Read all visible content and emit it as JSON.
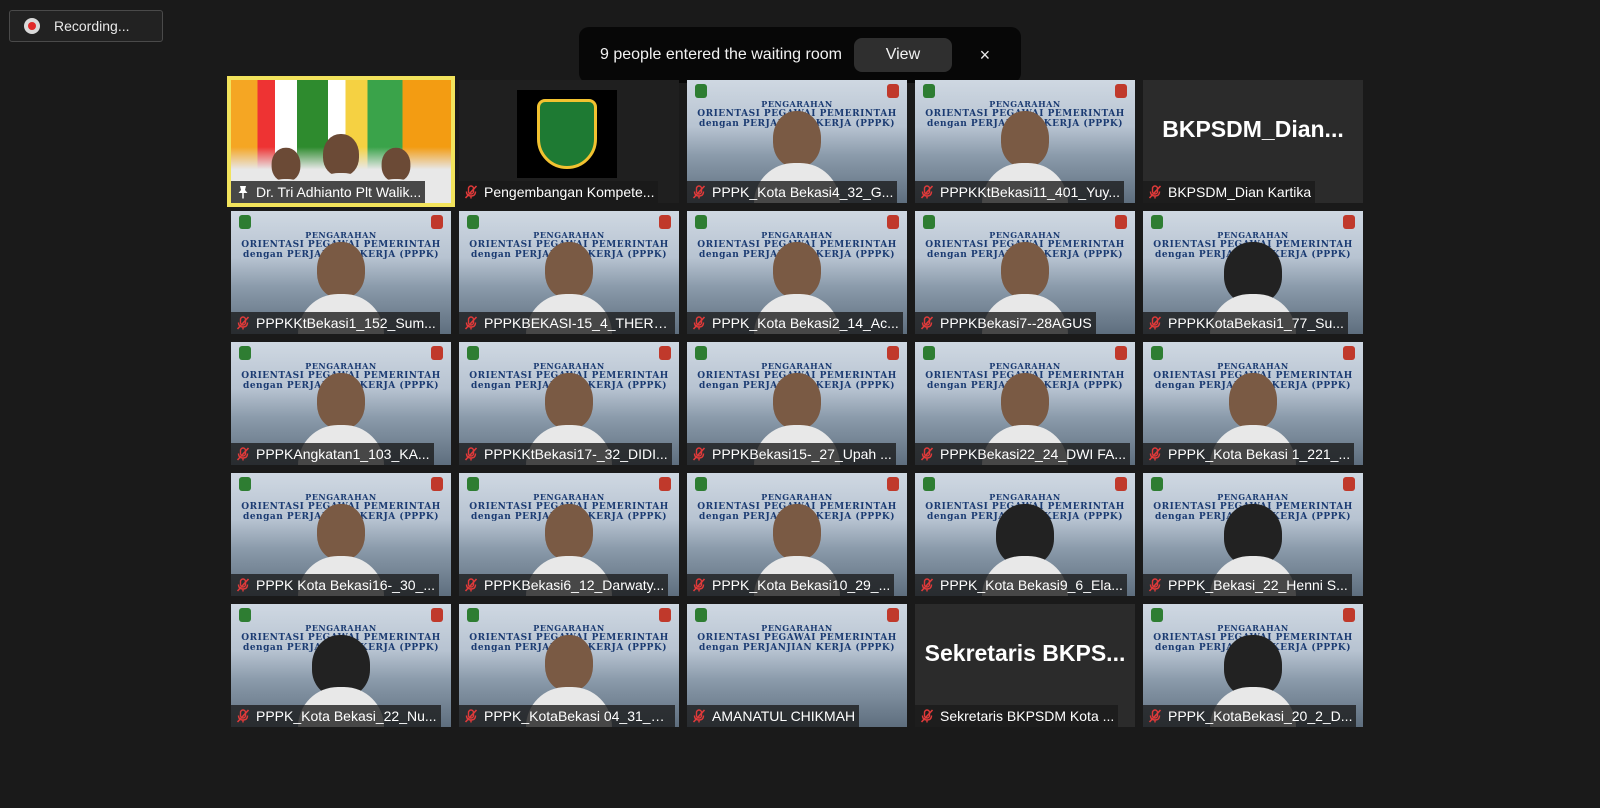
{
  "recording": {
    "label": "Recording..."
  },
  "notification": {
    "message": "9 people entered the waiting room",
    "view_label": "View",
    "close_label": "×"
  },
  "colors": {
    "active_speaker": "#f2e35c",
    "mic_muted": "#e03a3a",
    "background": "#1a1a1a"
  },
  "banner": {
    "line1": "PENGARAHAN",
    "line2": "ORIENTASI PEGAWAI PEMERINTAH",
    "line3": "dengan PERJANJIAN KERJA (PPPK)"
  },
  "participants": [
    {
      "name": "Dr. Tri Adhianto Plt Walik...",
      "type": "first",
      "icon": "pin-icon"
    },
    {
      "name": "Pengembangan Kompete...",
      "type": "logo",
      "icon": "mic-off-icon"
    },
    {
      "name": "PPPK_Kota Bekasi4_32_G...",
      "type": "video",
      "icon": "mic-off-icon"
    },
    {
      "name": "PPPKKtBekasi11_401_Yuy...",
      "type": "video",
      "icon": "mic-off-icon"
    },
    {
      "name": "BKPSDM_Dian Kartika",
      "type": "name",
      "display": "BKPSDM_Dian...",
      "icon": "mic-off-icon"
    },
    {
      "name": "PPPKKtBekasi1_152_Sum...",
      "type": "video",
      "icon": "mic-off-icon"
    },
    {
      "name": "PPPKBEKASI-15_4_THERE...",
      "type": "video",
      "icon": "mic-off-icon"
    },
    {
      "name": "PPPK_Kota Bekasi2_14_Ac...",
      "type": "video",
      "icon": "mic-off-icon"
    },
    {
      "name": "PPPKBekasi7--28AGUS",
      "type": "video",
      "icon": "mic-off-icon"
    },
    {
      "name": "PPPKKotaBekasi1_77_Su...",
      "type": "video",
      "hijab": true,
      "icon": "mic-off-icon"
    },
    {
      "name": "PPPKAngkatan1_103_KA...",
      "type": "video",
      "icon": "mic-off-icon"
    },
    {
      "name": "PPPKKtBekasi17-_32_DIDI...",
      "type": "video",
      "icon": "mic-off-icon"
    },
    {
      "name": "PPPKBekasi15-_27_Upah ...",
      "type": "video",
      "icon": "mic-off-icon"
    },
    {
      "name": "PPPKBekasi22_24_DWI FA...",
      "type": "video",
      "icon": "mic-off-icon"
    },
    {
      "name": "PPPK_Kota Bekasi 1_221_...",
      "type": "video",
      "icon": "mic-off-icon"
    },
    {
      "name": "PPPK Kota Bekasi16-_30_...",
      "type": "video",
      "icon": "mic-off-icon"
    },
    {
      "name": "PPPKBekasi6_12_Darwaty...",
      "type": "video",
      "icon": "mic-off-icon"
    },
    {
      "name": "PPPK_Kota Bekasi10_29_...",
      "type": "video",
      "icon": "mic-off-icon"
    },
    {
      "name": "PPPK_Kota Bekasi9_6_Ela...",
      "type": "video",
      "hijab": true,
      "icon": "mic-off-icon"
    },
    {
      "name": "PPPK_Bekasi_22_Henni S...",
      "type": "video",
      "hijab": true,
      "icon": "mic-off-icon"
    },
    {
      "name": "PPPK_Kota Bekasi_22_Nu...",
      "type": "video",
      "hijab": true,
      "icon": "mic-off-icon"
    },
    {
      "name": "PPPK_KotaBekasi 04_31_S...",
      "type": "video",
      "icon": "mic-off-icon"
    },
    {
      "name": "AMANATUL CHIKMAH",
      "type": "video",
      "noPerson": true,
      "icon": "mic-off-icon"
    },
    {
      "name": "Sekretaris BKPSDM Kota ...",
      "type": "name",
      "display": "Sekretaris BKPS...",
      "icon": "mic-off-icon"
    },
    {
      "name": "PPPK_KotaBekasi_20_2_D...",
      "type": "video",
      "hijab": true,
      "icon": "mic-off-icon"
    }
  ]
}
